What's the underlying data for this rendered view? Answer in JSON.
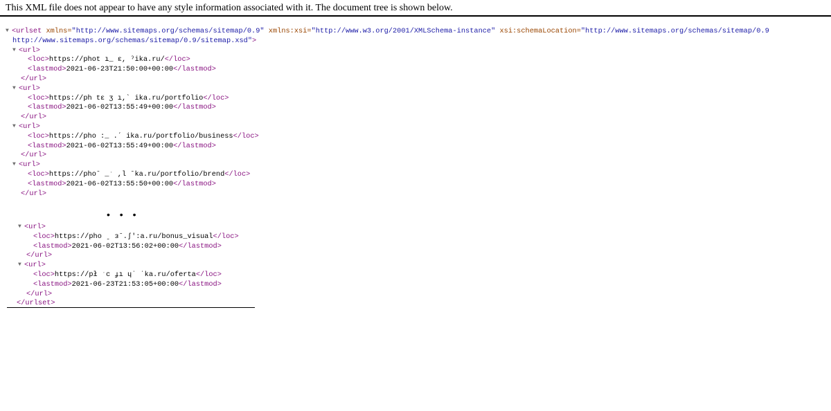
{
  "banner": {
    "text": "This XML file does not appear to have any style information associated with it. The document tree is shown below."
  },
  "urlset": {
    "open_tag_name": "<urlset",
    "attr1_name": "xmlns=",
    "attr1_value": "\"http://www.sitemaps.org/schemas/sitemap/0.9\"",
    "attr2_name": "xmlns:xsi=",
    "attr2_value": "\"http://www.w3.org/2001/XMLSchema-instance\"",
    "attr3_name": "xsi:schemaLocation=",
    "attr3_value_part1": "\"http://www.sitemaps.org/schemas/sitemap/0.9",
    "attr3_value_part2": "http://www.sitemaps.org/schemas/sitemap/0.9/sitemap.xsd\"",
    "open_tag_close": ">",
    "close_tag": "</urlset>"
  },
  "tags": {
    "url_open": "<url>",
    "url_close": "</url>",
    "loc_open": "<loc>",
    "loc_close": "</loc>",
    "lastmod_open": "<lastmod>",
    "lastmod_close": "</lastmod>"
  },
  "ellipsis": "• • •",
  "urls_top": [
    {
      "loc": "https://phot ı_ ɛ, ˀika.ru/",
      "lastmod": "2021-06-23T21:50:00+00:00"
    },
    {
      "loc": "https://ph tɛ ʒ ı,ˋ ika.ru/portfolio",
      "lastmod": "2021-06-02T13:55:49+00:00"
    },
    {
      "loc": "https://pho :_  .ˊ ika.ru/portfolio/business",
      "lastmod": "2021-06-02T13:55:49+00:00"
    },
    {
      "loc": "https://phoˉ  _ˑ ,l ˉka.ru/portfolio/brend",
      "lastmod": "2021-06-02T13:55:50+00:00"
    }
  ],
  "urls_bottom": [
    {
      "loc": "https://pho  ˍ ɜˉ.ʃ':a.ru/bonus_visual",
      "lastmod": "2021-06-02T13:56:02+00:00"
    },
    {
      "loc": "https://pł  ˑc ɟı ɥˈ ˈka.ru/oferta",
      "lastmod": "2021-06-23T21:53:05+00:00"
    }
  ]
}
